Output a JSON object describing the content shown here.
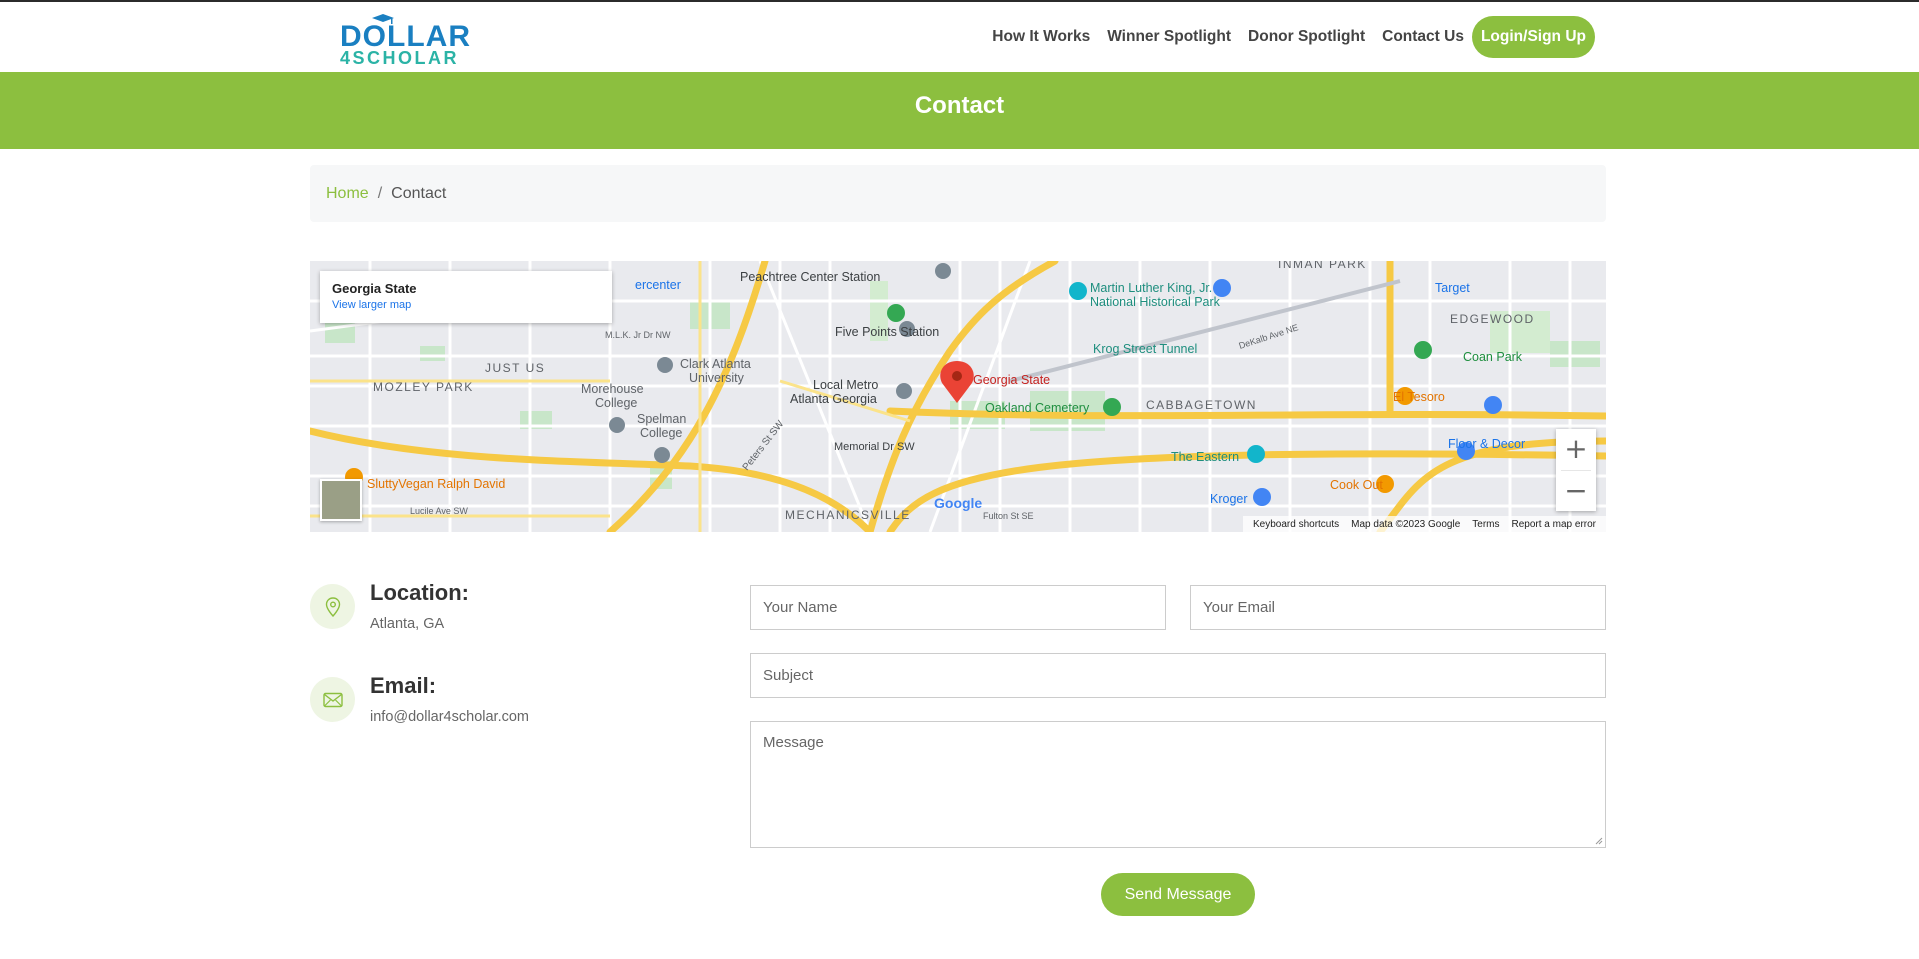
{
  "nav": {
    "logo_line1": "DOLLAR",
    "logo_line2": "4SCHOLAR",
    "links": [
      "How It Works",
      "Winner Spotlight",
      "Donor Spotlight",
      "Contact Us"
    ],
    "cta": "Login/Sign Up"
  },
  "banner": {
    "title": "Contact"
  },
  "breadcrumb": {
    "home": "Home",
    "separator": "/",
    "current": "Contact"
  },
  "map": {
    "place_name": "Georgia State",
    "view_larger": "View larger map",
    "zoom_in": "+",
    "zoom_out": "−",
    "brand": "Google",
    "footer": [
      "Keyboard shortcuts",
      "Map data ©2023 Google",
      "Terms",
      "Report a map error"
    ],
    "labels": {
      "peachtree": "Peachtree Center Station",
      "five_points": "Five Points Station",
      "mlk_park": "Martin Luther King, Jr.",
      "mlk_park2": "National Historical Park",
      "inman": "INMAN PARK",
      "target": "Target",
      "edgewood": "EDGEWOOD",
      "coan": "Coan Park",
      "krog": "Krog Street Tunnel",
      "dekalb": "DeKalb Ave NE",
      "georgia_state": "Georgia State",
      "local_metro": "Local Metro",
      "local_metro2": "Atlanta Georgia",
      "oakland": "Oakland Cemetery",
      "cabbagetown": "CABBAGETOWN",
      "el_tesoro": "El Tesoro",
      "floor_decor": "Floor & Decor",
      "the_eastern": "The Eastern",
      "kroger": "Kroger",
      "cook_out": "Cook Out",
      "mlk_dr": "M.L.K. Jr Dr NW",
      "just_us": "JUST US",
      "mozley": "MOZLEY PARK",
      "clark": "Clark Atlanta",
      "clark2": "University",
      "morehouse": "Morehouse",
      "morehouse2": "College",
      "spelman": "Spelman",
      "spelman2": "College",
      "peters": "Peters St SW",
      "memorial": "Memorial Dr SW",
      "mechanicsville": "MECHANICSVILLE",
      "slutty": "SluttyVegan Ralph David",
      "lucile": "Lucile Ave SW",
      "fulton": "Fulton St SE",
      "center": "ercenter"
    }
  },
  "contact": {
    "location_title": "Location:",
    "location_text": "Atlanta, GA",
    "email_title": "Email:",
    "email_text": "info@dollar4scholar.com"
  },
  "form": {
    "name_placeholder": "Your Name",
    "email_placeholder": "Your Email",
    "subject_placeholder": "Subject",
    "message_placeholder": "Message",
    "submit": "Send Message"
  },
  "colors": {
    "brand_green": "#8cbf3f",
    "brand_blue": "#1a7fc1",
    "brand_teal": "#2bb3a6"
  }
}
